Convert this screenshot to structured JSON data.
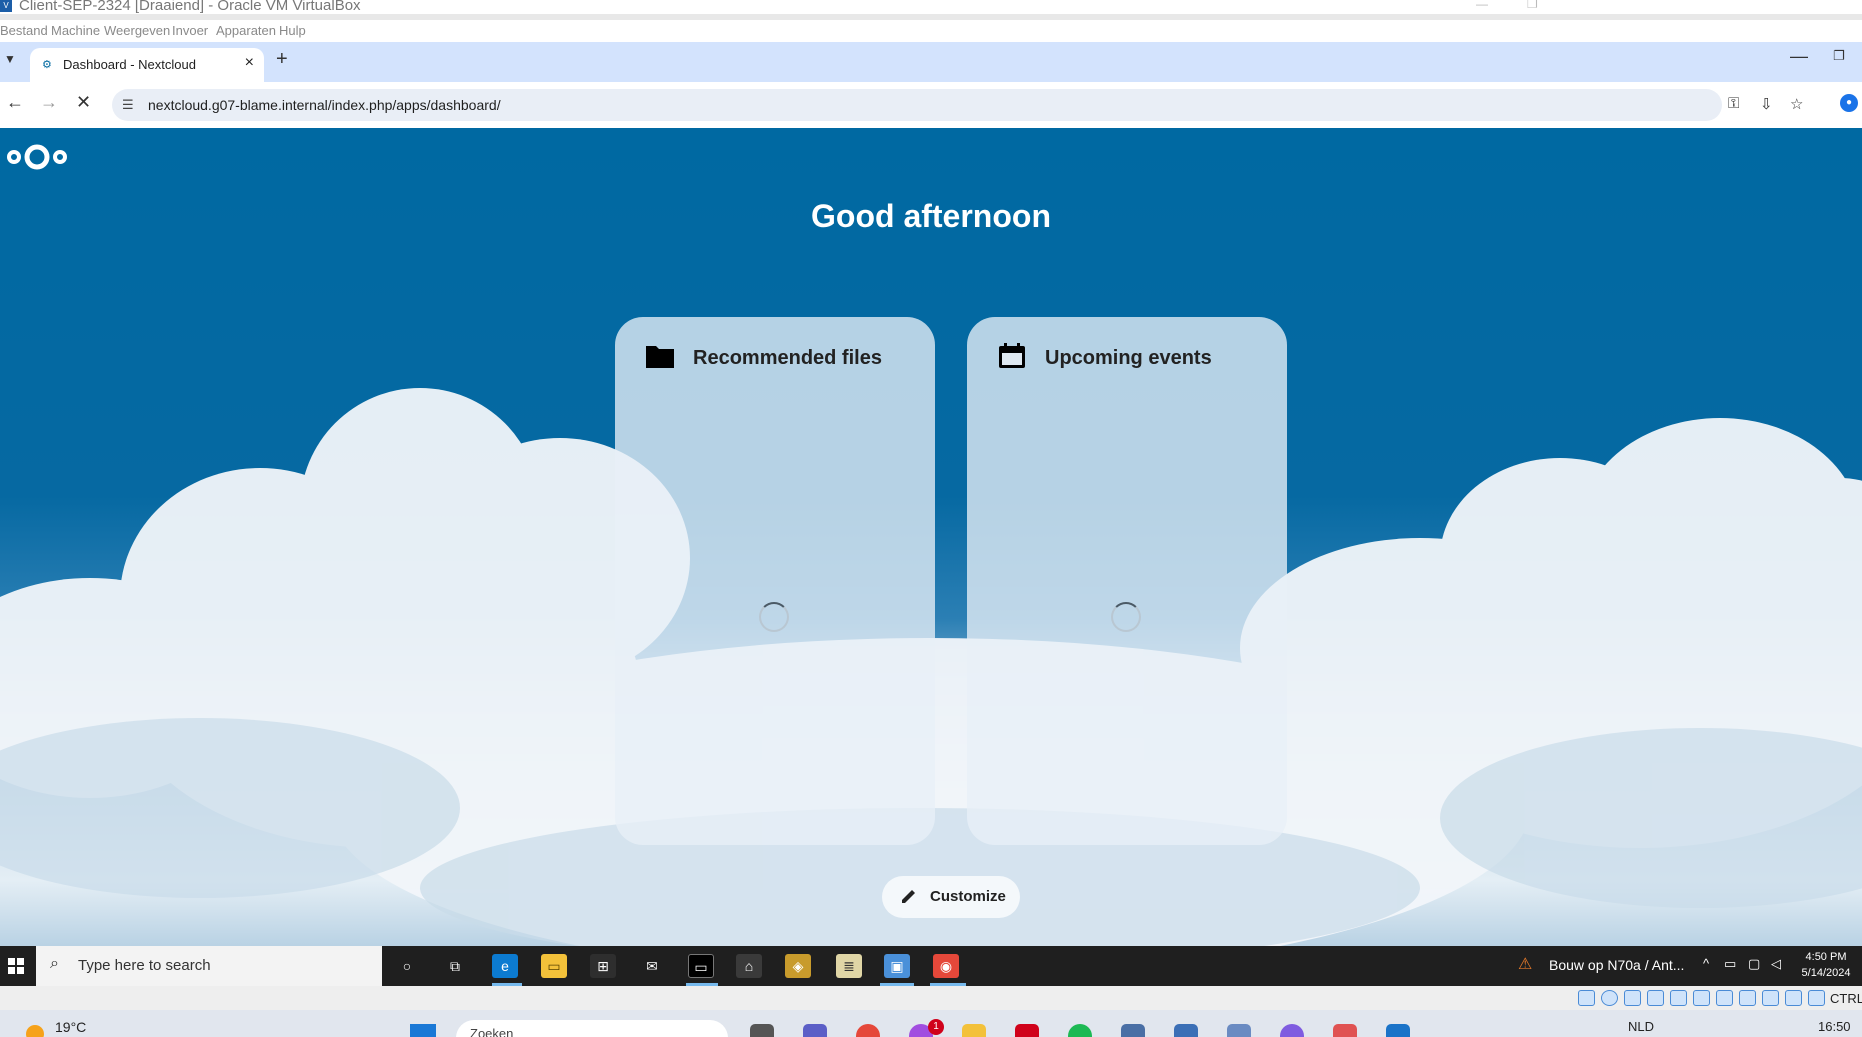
{
  "vbox": {
    "window_title": "Client-SEP-2324 [Draaiend] - Oracle VM VirtualBox",
    "menu": [
      "Bestand",
      "Machine",
      "Weergeven",
      "Invoer",
      "Apparaten",
      "Hulp"
    ],
    "status_ctrl": "CTRL"
  },
  "browser": {
    "tab_title": "Dashboard - Nextcloud",
    "url": "nextcloud.g07-blame.internal/index.php/apps/dashboard/"
  },
  "nextcloud": {
    "greeting": "Good afternoon",
    "panels": [
      {
        "title": "Recommended files",
        "icon": "folder-icon"
      },
      {
        "title": "Upcoming events",
        "icon": "calendar-icon"
      }
    ],
    "customize_label": "Customize"
  },
  "taskbar": {
    "search_placeholder": "Type here to search",
    "news": "Bouw op N70a / Ant...",
    "time": "4:50 PM",
    "date": "5/14/2024"
  },
  "host": {
    "temperature": "19°C",
    "search_placeholder": "Zoeken",
    "badge_count": "1",
    "language": "NLD",
    "time": "16:50"
  },
  "colors": {
    "nextcloud_blue": "#0069a2",
    "taskbar": "#1f1f1f",
    "tab_strip": "#d3e3fd"
  }
}
